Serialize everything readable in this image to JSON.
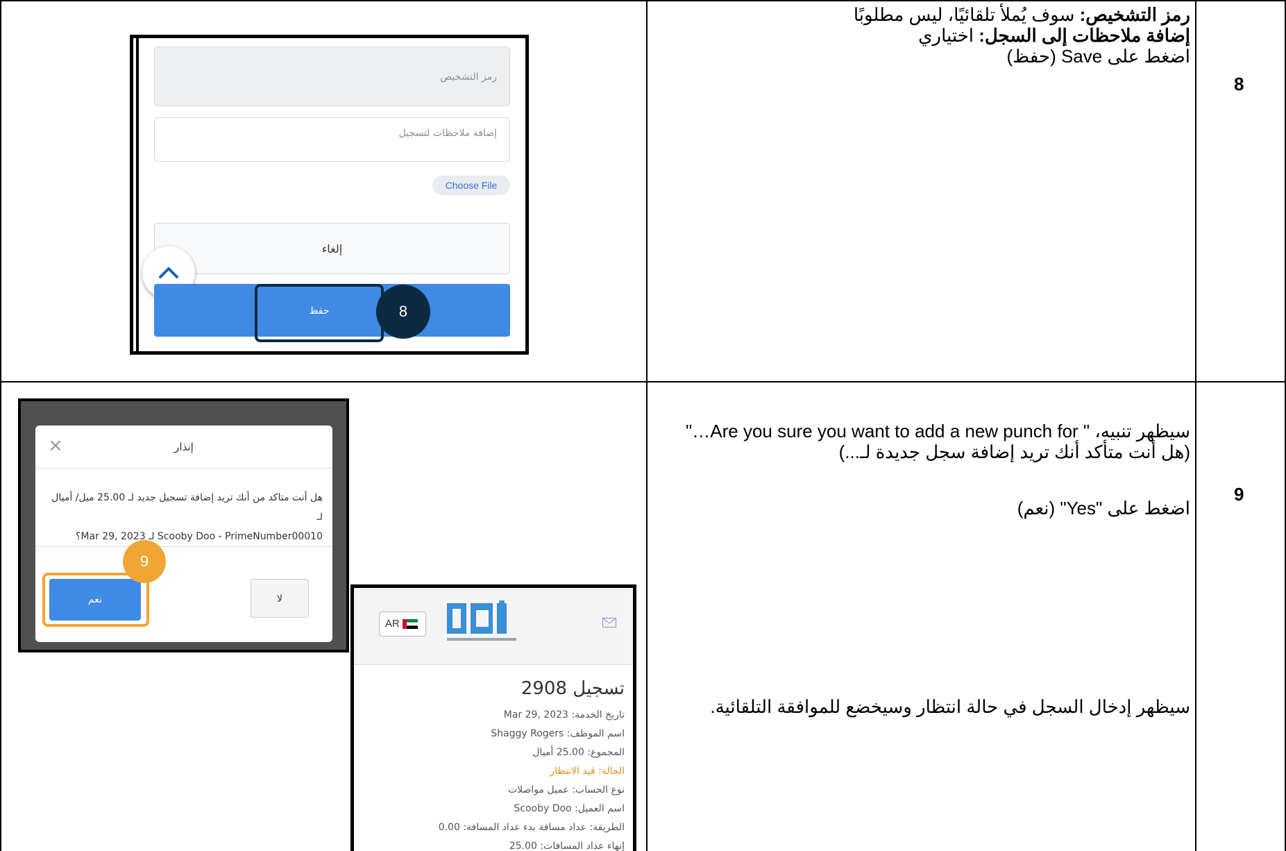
{
  "rows": [
    {
      "step": "8",
      "lines": [
        {
          "bold": "رمز التشخيص:",
          "text": " سوف يُملأ تلقائيًا، ليس مطلوبًا"
        },
        {
          "bold": "إضافة ملاحظات إلى السجل:",
          "text": " اختياري"
        },
        {
          "bold": "",
          "text": "اضغط على Save (حفظ)"
        }
      ],
      "screenshot": {
        "diagnosis_placeholder": "رمز التشخيص",
        "notes_placeholder": "إضافة ملاحظات لتسجيل",
        "choose_file": "Choose File",
        "cancel": "إلغاء",
        "save": "حفظ",
        "badge": "8"
      }
    },
    {
      "step": "9",
      "paragraph1": "سيظهر تنبيه، \" Are you sure you want to add a new punch for…\" (هل أنت متأكد أنك تريد إضافة سجل جديدة لـ...)",
      "paragraph2": "اضغط على \"Yes\" (نعم)",
      "paragraph3": "سيظهر إدخال السجل في حالة انتظار وسيخضع للموافقة التلقائية.",
      "dialog": {
        "title": "إنذار",
        "close": "×",
        "message_line1": "هل أنت متاكد من أنك تريد إضافة تسجيل جديد لـ 25.00 ميل/ أميال لـ",
        "message_line2": "Scooby Doo - PrimeNumber00010 لـ Mar 29, 2023؟",
        "no": "لا",
        "yes": "نعم",
        "badge": "9"
      },
      "detail": {
        "lang": "AR",
        "title": "تسجيل 2908",
        "service_date": "تاريخ الخدمة: Mar 29, 2023",
        "employee": "اسم الموظف: Shaggy Rogers",
        "total": "المجموع: 25.00 أميال",
        "status": "الحالة: قيد الانتظار",
        "account_type": "نوع الحساب: عميل مواصلات",
        "client": "اسم العميل: Scooby Doo",
        "method": "الطريقة: عداد مسافة بدء عداد المسافة: 0.00",
        "end": "إنهاء عداد المسافات: 25.00"
      }
    }
  ],
  "colors": {
    "primary_button": "#3f8ae4",
    "badge_8": "#0d2a43",
    "badge_9": "#f0a535",
    "status_pending": "#e38f1f"
  }
}
